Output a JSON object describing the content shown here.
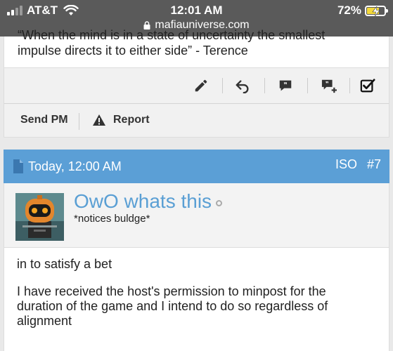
{
  "status_bar": {
    "carrier": "AT&T",
    "time": "12:01 AM",
    "url": "mafiauniverse.com",
    "battery_percent": "72%",
    "battery_level": 0.72,
    "signal_bars": 2
  },
  "previous_post": {
    "quote_partial": "“When the mind is in a state of uncertainty the smallest",
    "quote_line": "impulse directs it to either side” - Terence",
    "toolbar_icons": [
      "edit-pencil-icon",
      "reply-arrow-icon",
      "quote-icon",
      "multi-quote-icon",
      "checkbox-icon"
    ],
    "actions": {
      "send_pm": "Send PM",
      "report": "Report"
    }
  },
  "post": {
    "date": "Today, 12:00 AM",
    "iso": "ISO",
    "number": "#7",
    "username": "OwO whats this",
    "user_title": "*notices buldge*",
    "body_line": "in to satisfy a bet",
    "body_paragraph": "I have received the host's permission to minpost for the duration of the game and I intend to do so regardless of alignment"
  },
  "colors": {
    "status_bar_bg": "#5a5a5a",
    "post_header_bg": "#5b9fd6",
    "username": "#5a9fd4",
    "battery_fill": "#f4d93b"
  }
}
